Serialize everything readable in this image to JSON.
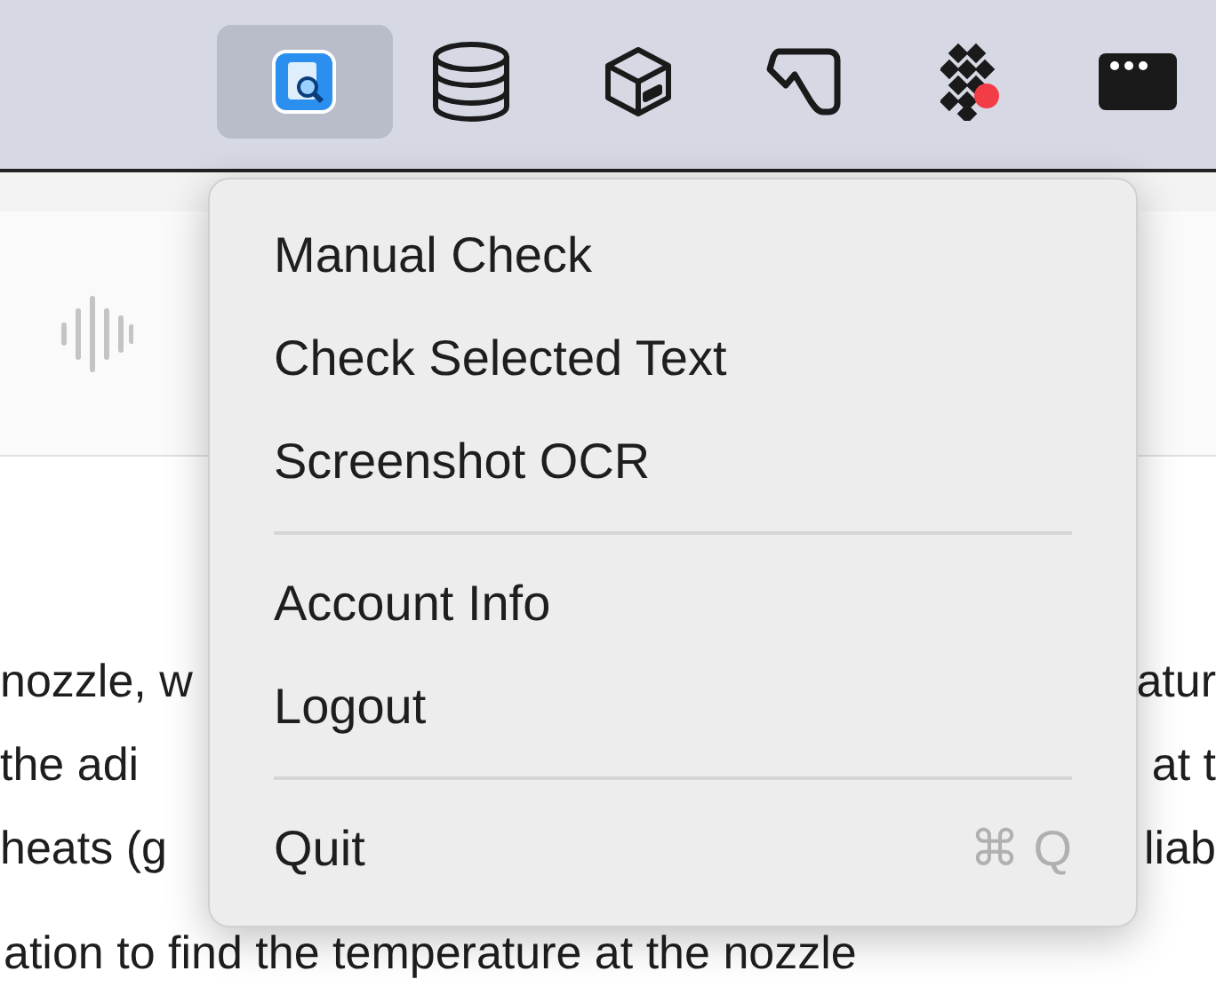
{
  "menu_bar": {
    "icons": [
      {
        "kind": "app",
        "selected": true
      },
      {
        "kind": "database",
        "selected": false
      },
      {
        "kind": "box",
        "selected": false
      },
      {
        "kind": "tag",
        "selected": false
      },
      {
        "kind": "dots",
        "selected": false
      },
      {
        "kind": "window",
        "selected": false
      }
    ]
  },
  "document": {
    "lines": [
      {
        "left": "nozzle, w",
        "right": "atur"
      },
      {
        "left": "the adi",
        "right": "at t"
      },
      {
        "left": "heats (g",
        "right": "liab"
      },
      {
        "left": "ation to find the temperature at the nozzle"
      }
    ]
  },
  "menu": {
    "groups": [
      [
        {
          "label": "Manual Check"
        },
        {
          "label": "Check Selected Text"
        },
        {
          "label": "Screenshot OCR"
        }
      ],
      [
        {
          "label": "Account Info"
        },
        {
          "label": "Logout"
        }
      ],
      [
        {
          "label": "Quit",
          "shortcut": "⌘ Q"
        }
      ]
    ]
  }
}
